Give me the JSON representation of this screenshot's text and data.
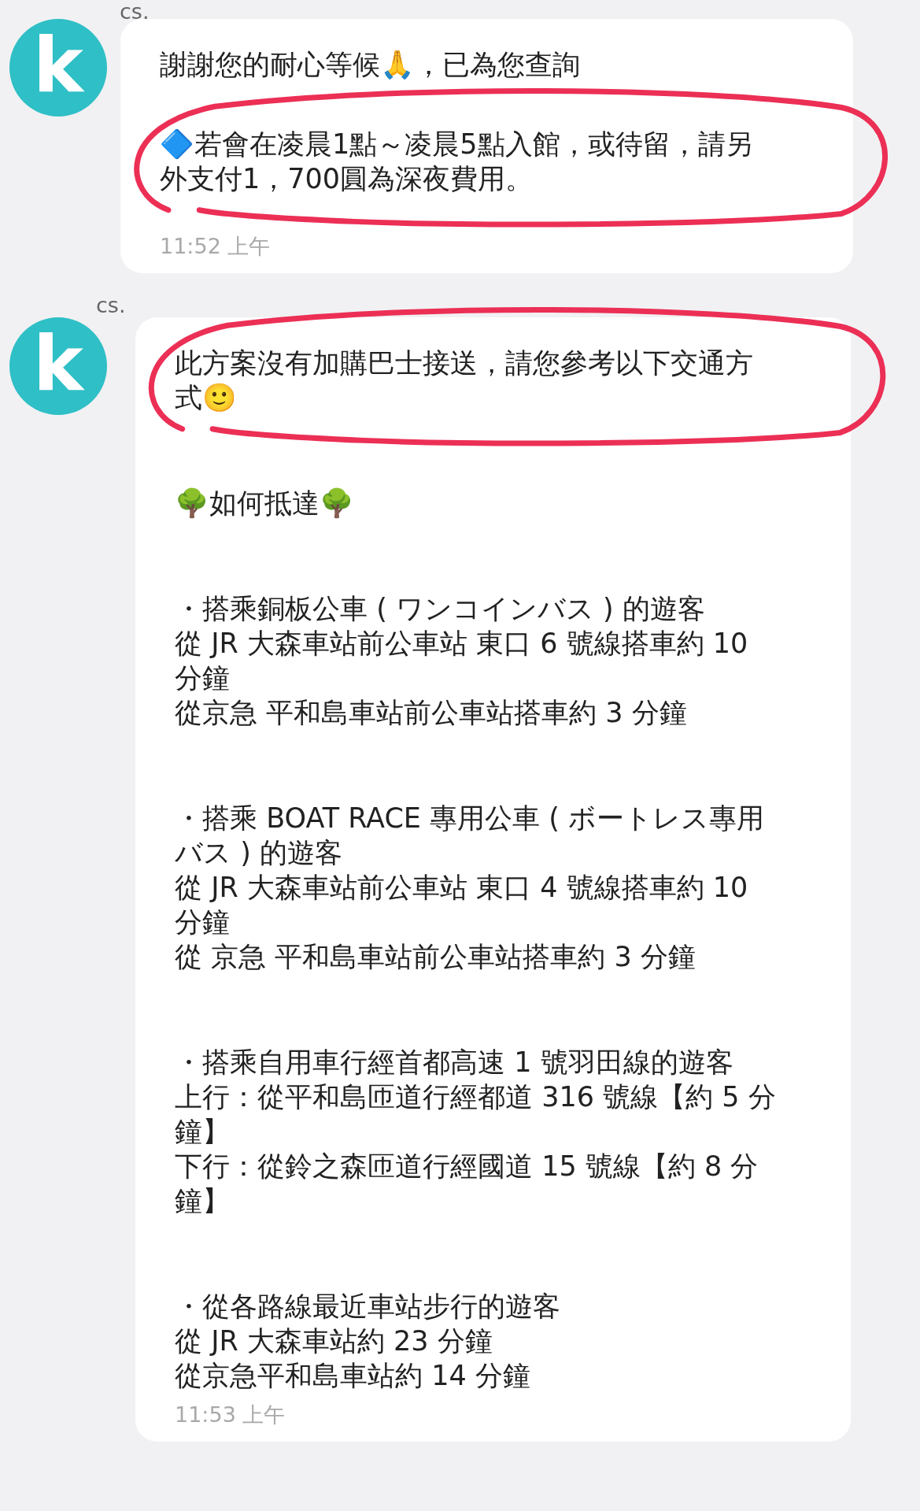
{
  "messages": [
    {
      "sender": "cs.",
      "avatar": "k",
      "time": "11:52 上午",
      "paragraphs": [
        {
          "lines": [
            "謝謝您的耐心等候🙏，已為您查詢"
          ],
          "highlighted": false
        },
        {
          "lines": [
            "🔷若會在凌晨1點～凌晨5點入館，或待留，請另",
            "外支付1，700圓為深夜費用。"
          ],
          "highlighted": true
        }
      ]
    },
    {
      "sender": "cs.",
      "avatar": "k",
      "time": "11:53 上午",
      "paragraphs": [
        {
          "lines": [
            "此方案沒有加購巴士接送，請您參考以下交通方",
            "式🙂"
          ],
          "highlighted": true
        },
        {
          "lines": [
            "🌳如何抵達🌳"
          ],
          "highlighted": false
        },
        {
          "lines": [
            "・搭乘銅板公車 ( ワンコインバス ) 的遊客",
            "從 JR 大森車站前公車站 東口 6 號線搭車約 10",
            "分鐘",
            "從京急 平和島車站前公車站搭車約 3 分鐘"
          ],
          "highlighted": false
        },
        {
          "lines": [
            "・搭乘 BOAT RACE 專用公車 ( ボートレス專用",
            "バス ) 的遊客",
            "從 JR 大森車站前公車站 東口 4 號線搭車約 10",
            "分鐘",
            "從 京急 平和島車站前公車站搭車約 3 分鐘"
          ],
          "highlighted": false
        },
        {
          "lines": [
            "・搭乘自用車行經首都高速 1 號羽田線的遊客",
            "上行：從平和島匝道行經都道 316 號線【約 5 分",
            "鐘】",
            "下行：從鈴之森匝道行經國道 15 號線【約 8 分",
            "鐘】"
          ],
          "highlighted": false
        },
        {
          "lines": [
            "・從各路線最近車站步行的遊客",
            "從 JR 大森車站約 23 分鐘",
            "從京急平和島車站約 14 分鐘"
          ],
          "highlighted": false
        }
      ]
    }
  ]
}
